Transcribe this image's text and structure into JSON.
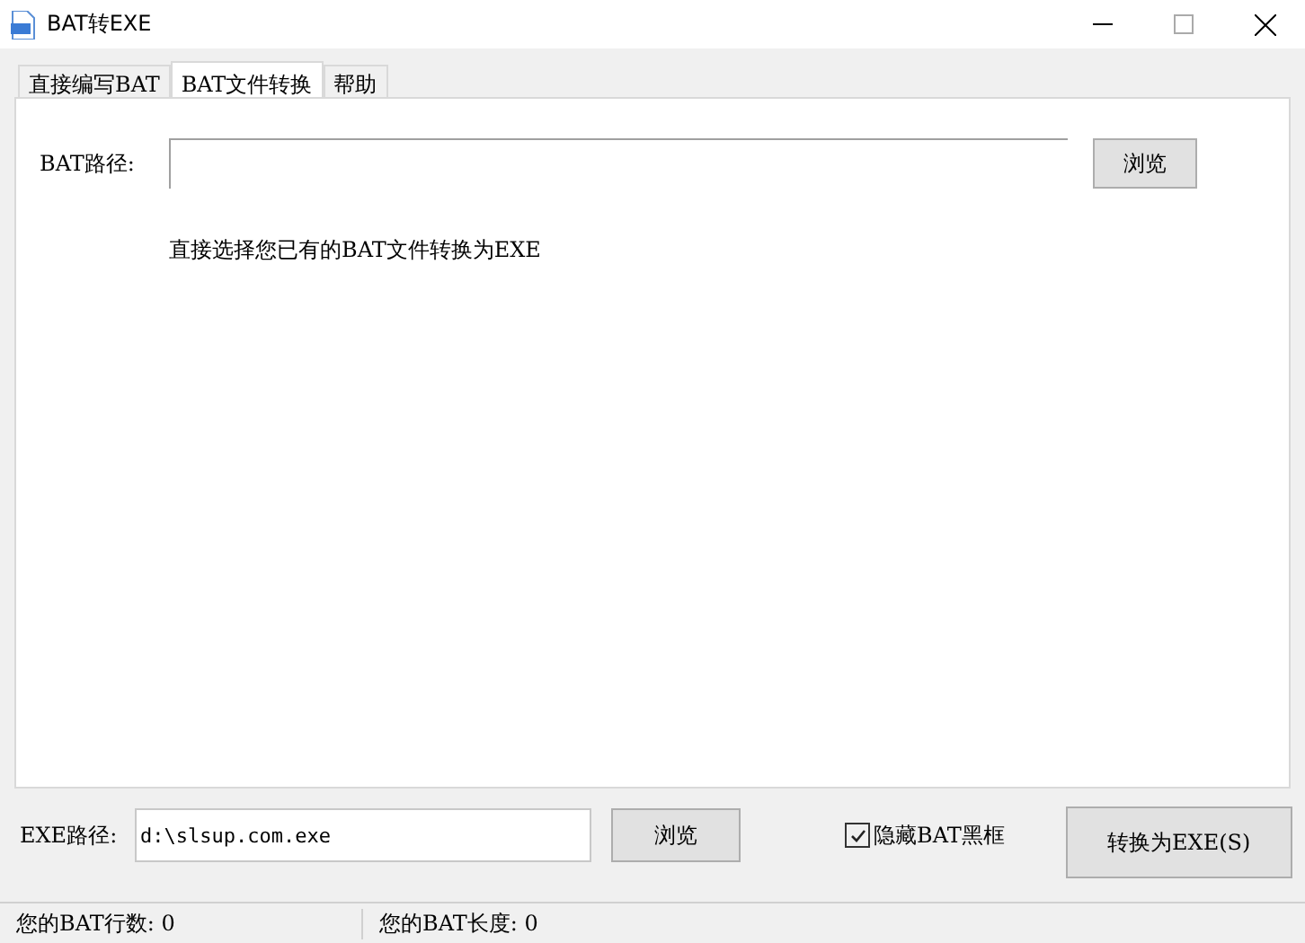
{
  "window": {
    "title": "BAT转EXE"
  },
  "tabs": [
    {
      "label": "直接编写BAT",
      "selected": false
    },
    {
      "label": "BAT文件转换",
      "selected": true
    },
    {
      "label": "帮助",
      "selected": false
    }
  ],
  "panel": {
    "path_label": "BAT路径:",
    "browse": "浏览",
    "hint": "直接选择您已有的BAT文件转换为EXE"
  },
  "output": {
    "label": "EXE路径:",
    "value": "d:\\slsup.com.exe",
    "browse": "浏览",
    "hide_console": {
      "label": "隐藏BAT黑框",
      "checked": true
    },
    "convert": "转换为EXE(S)"
  },
  "status_bar": [
    "您的BAT行数: 0",
    "您的BAT长度: 0"
  ]
}
